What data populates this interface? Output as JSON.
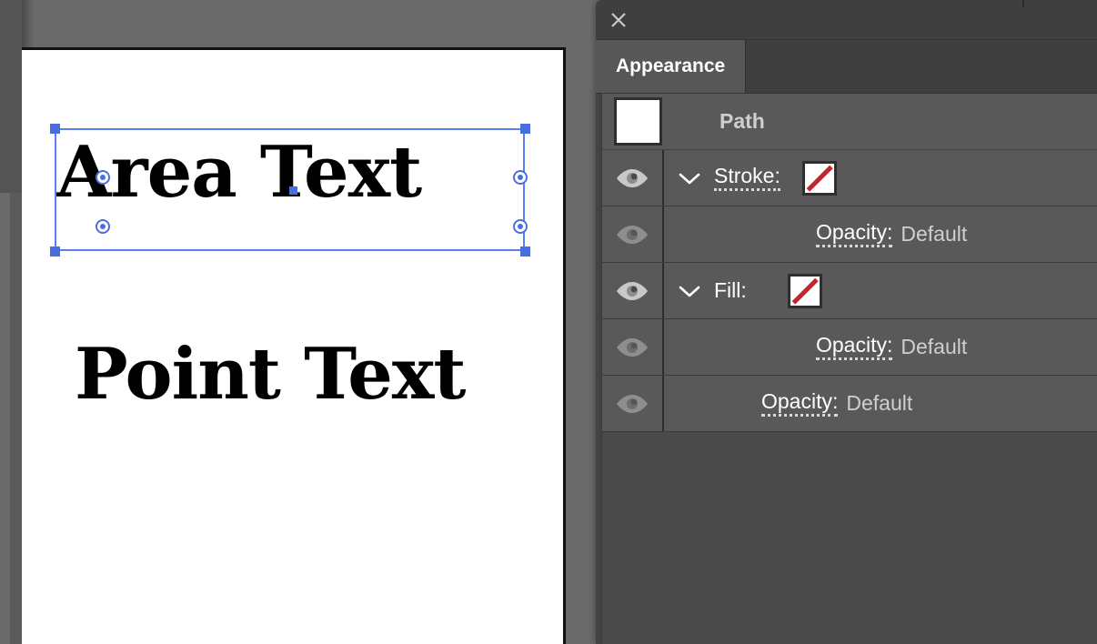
{
  "canvas": {
    "area_text": "Area Text",
    "point_text": "Point Text",
    "selection": {
      "handle_color": "#4a6ee0",
      "box_color": "#5b7ef0"
    }
  },
  "panel": {
    "close_icon": "close-icon",
    "tabs": [
      {
        "label": "Appearance",
        "active": true
      }
    ],
    "rows": [
      {
        "name": "path",
        "type": "header",
        "eye": "none",
        "chevron": "none",
        "thumbnail": "#ffffff",
        "label": "Path"
      },
      {
        "name": "stroke",
        "type": "property",
        "eye": "visible",
        "chevron": "chevron-down-icon",
        "key": "Stroke:",
        "value": "",
        "swatch": "none-swatch",
        "swatch_color": "#c0272d",
        "indent": 1
      },
      {
        "name": "stroke-opacity",
        "type": "property",
        "eye": "dimmed",
        "chevron": "none",
        "key": "Opacity:",
        "value": "Default",
        "indent": 2
      },
      {
        "name": "fill",
        "type": "property",
        "eye": "visible",
        "chevron": "chevron-down-icon",
        "key": "Fill:",
        "value": "",
        "swatch": "none-swatch",
        "swatch_color": "#c0272d",
        "indent": 1
      },
      {
        "name": "fill-opacity",
        "type": "property",
        "eye": "dimmed",
        "chevron": "none",
        "key": "Opacity:",
        "value": "Default",
        "indent": 2
      },
      {
        "name": "object-opacity",
        "type": "property",
        "eye": "dimmed",
        "chevron": "none",
        "key": "Opacity:",
        "value": "Default",
        "indent": 1
      }
    ]
  },
  "colors": {
    "panel_bg": "#434343",
    "row_bg": "#5a5959",
    "tab_active_bg": "#585757",
    "app_bg": "#6a6a6a",
    "swatch_red": "#c0272d",
    "selection_blue": "#4a6ee0"
  }
}
